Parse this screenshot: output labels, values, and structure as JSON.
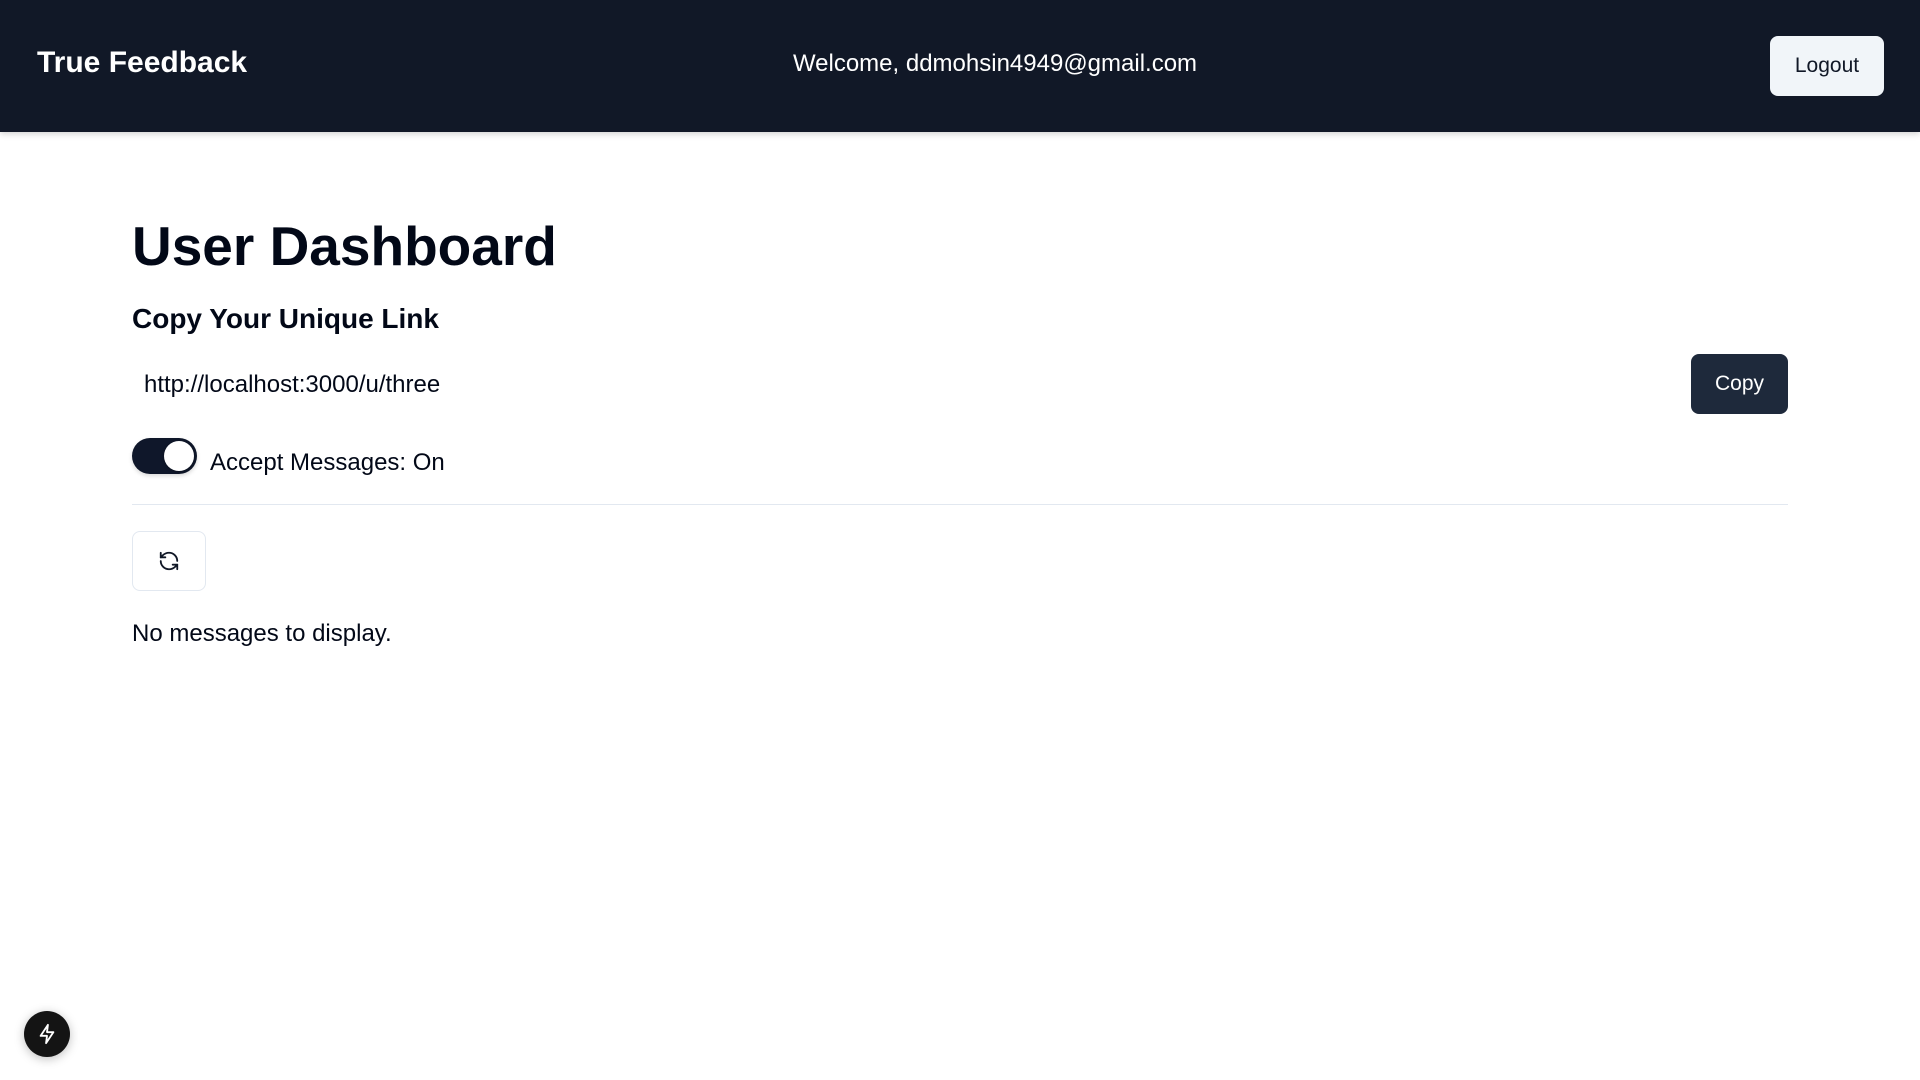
{
  "navbar": {
    "brand": "True Feedback",
    "welcome_text": "Welcome, ddmohsin4949@gmail.com",
    "logout_label": "Logout"
  },
  "main": {
    "page_title": "User Dashboard",
    "link_section_title": "Copy Your Unique Link",
    "unique_link_value": "http://localhost:3000/u/three",
    "copy_label": "Copy",
    "accept_messages_label": "Accept Messages: On",
    "accept_messages_on": true,
    "refresh_icon": "refresh-icon",
    "empty_state_text": "No messages to display."
  },
  "dev_indicator": {
    "icon": "lightning-icon"
  },
  "colors": {
    "navbar_bg": "#111827",
    "primary_button": "#1e293b",
    "switch_on": "#0f172a",
    "text": "#020817"
  }
}
